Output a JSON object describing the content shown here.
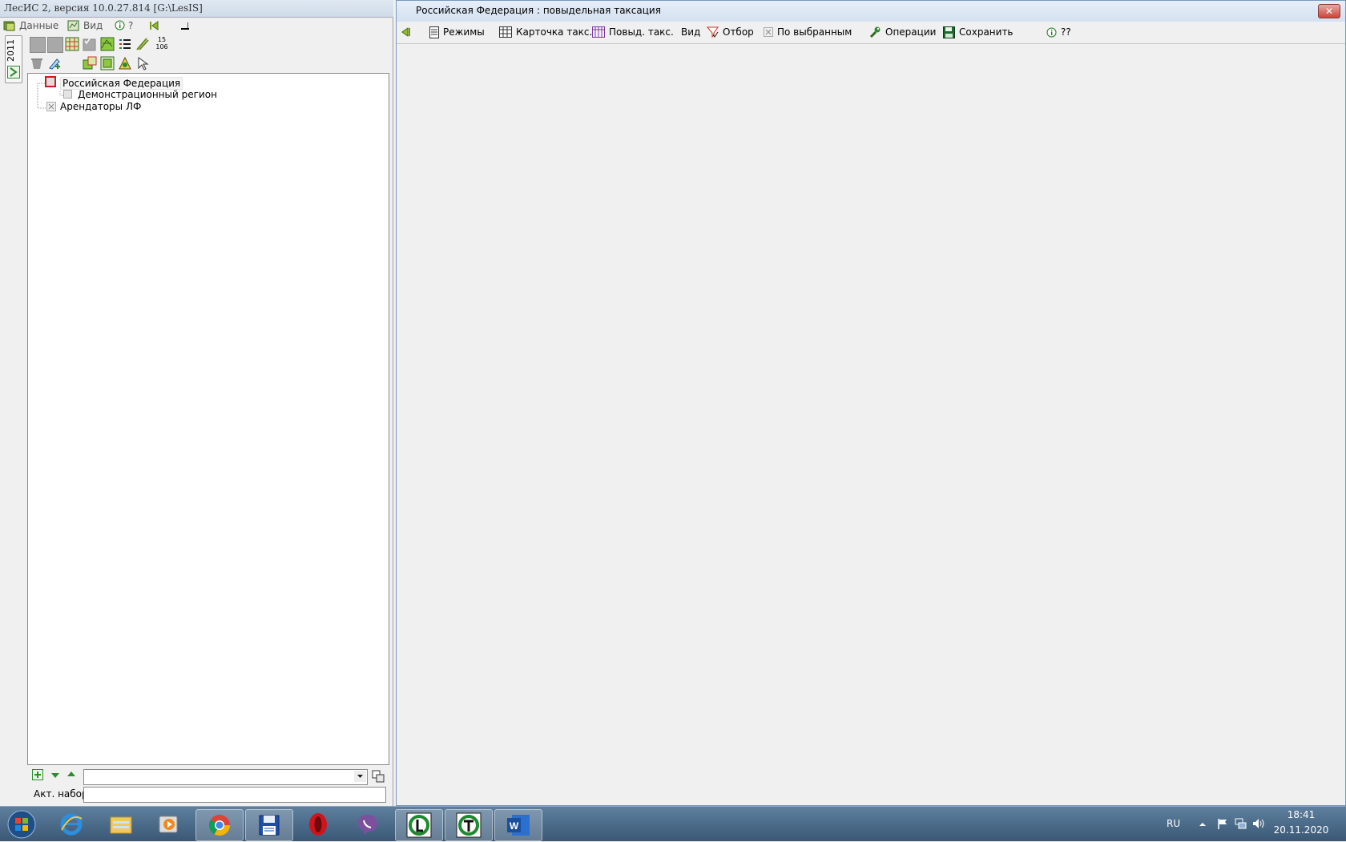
{
  "left_window": {
    "title": "ЛесИС 2, версия 10.0.27.814  [G:\\LesIS]",
    "menu": {
      "data": "Данные",
      "view": "Вид",
      "help": "?"
    },
    "vertical_tab": "2011",
    "toolbar_counter_top": "15",
    "toolbar_counter_bottom": "106",
    "tree": {
      "root": "Российская Федерация",
      "child": "Демонстрационный  регион",
      "second_root": "Арендаторы ЛФ"
    },
    "bottom": {
      "filter_value": "",
      "active_set_label": "Акт. набор",
      "active_set_value": ""
    }
  },
  "right_window": {
    "title": "Российская Федерация : повыдельная таксация",
    "toolbar": {
      "modes": "Режимы",
      "card": "Карточка такс.",
      "plot": "Повыд. такс.",
      "view": "Вид",
      "filter": "Отбор",
      "by_selected": "По выбранным",
      "operations": "Операции",
      "save": "Сохранить",
      "help": "??"
    },
    "close_glyph": "✕"
  },
  "taskbar": {
    "lang": "RU",
    "time": "18:41",
    "date": "20.11.2020",
    "word_letter": "W"
  },
  "colors": {
    "icon_green": "#2e8b2e",
    "taskbar": "#3f5f7e",
    "title_bar": "#d9e4f0"
  }
}
